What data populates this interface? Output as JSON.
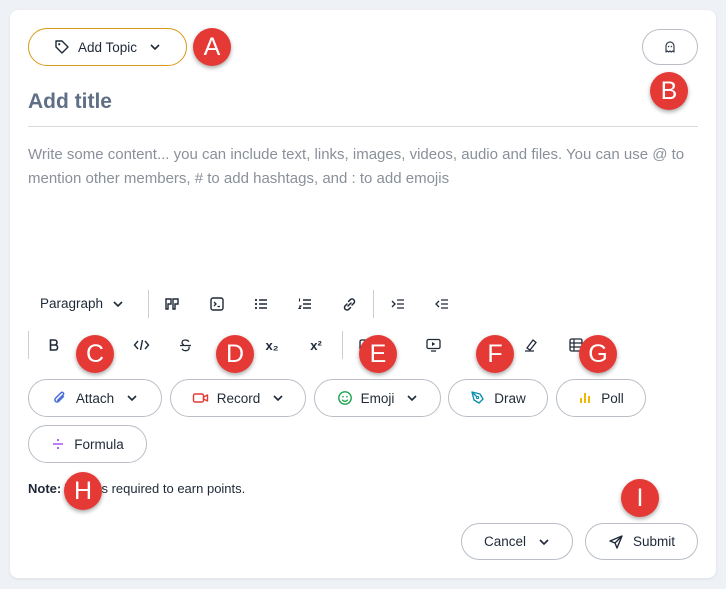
{
  "header": {
    "add_topic_label": "Add Topic",
    "title_placeholder": "Add title",
    "content_placeholder": "Write some content... you can include text, links, images, videos, audio and files. You can use @ to mention other members, # to add hashtags, and : to add emojis"
  },
  "toolbar": {
    "paragraph_label": "Paragraph",
    "subscript_label": "x₂",
    "superscript_label": "x²"
  },
  "actions": {
    "attach_label": "Attach",
    "record_label": "Record",
    "emoji_label": "Emoji",
    "draw_label": "Draw",
    "poll_label": "Poll",
    "formula_label": "Formula"
  },
  "note": {
    "prefix": "Note:",
    "text": "Topic is required to earn points."
  },
  "footer": {
    "cancel_label": "Cancel",
    "submit_label": "Submit"
  },
  "annotations": {
    "A": "A",
    "B": "B",
    "C": "C",
    "D": "D",
    "E": "E",
    "F": "F",
    "G": "G",
    "H": "H",
    "I": "I"
  },
  "colors": {
    "topic_border": "#d99a1a",
    "record_icon": "#e53935",
    "emoji_icon": "#16a34a",
    "draw_icon": "#0e8fb0",
    "poll_icon": "#f2b705",
    "formula_icon": "#a855f7",
    "attach_icon": "#4f6fd8",
    "badge": "#e53935"
  }
}
